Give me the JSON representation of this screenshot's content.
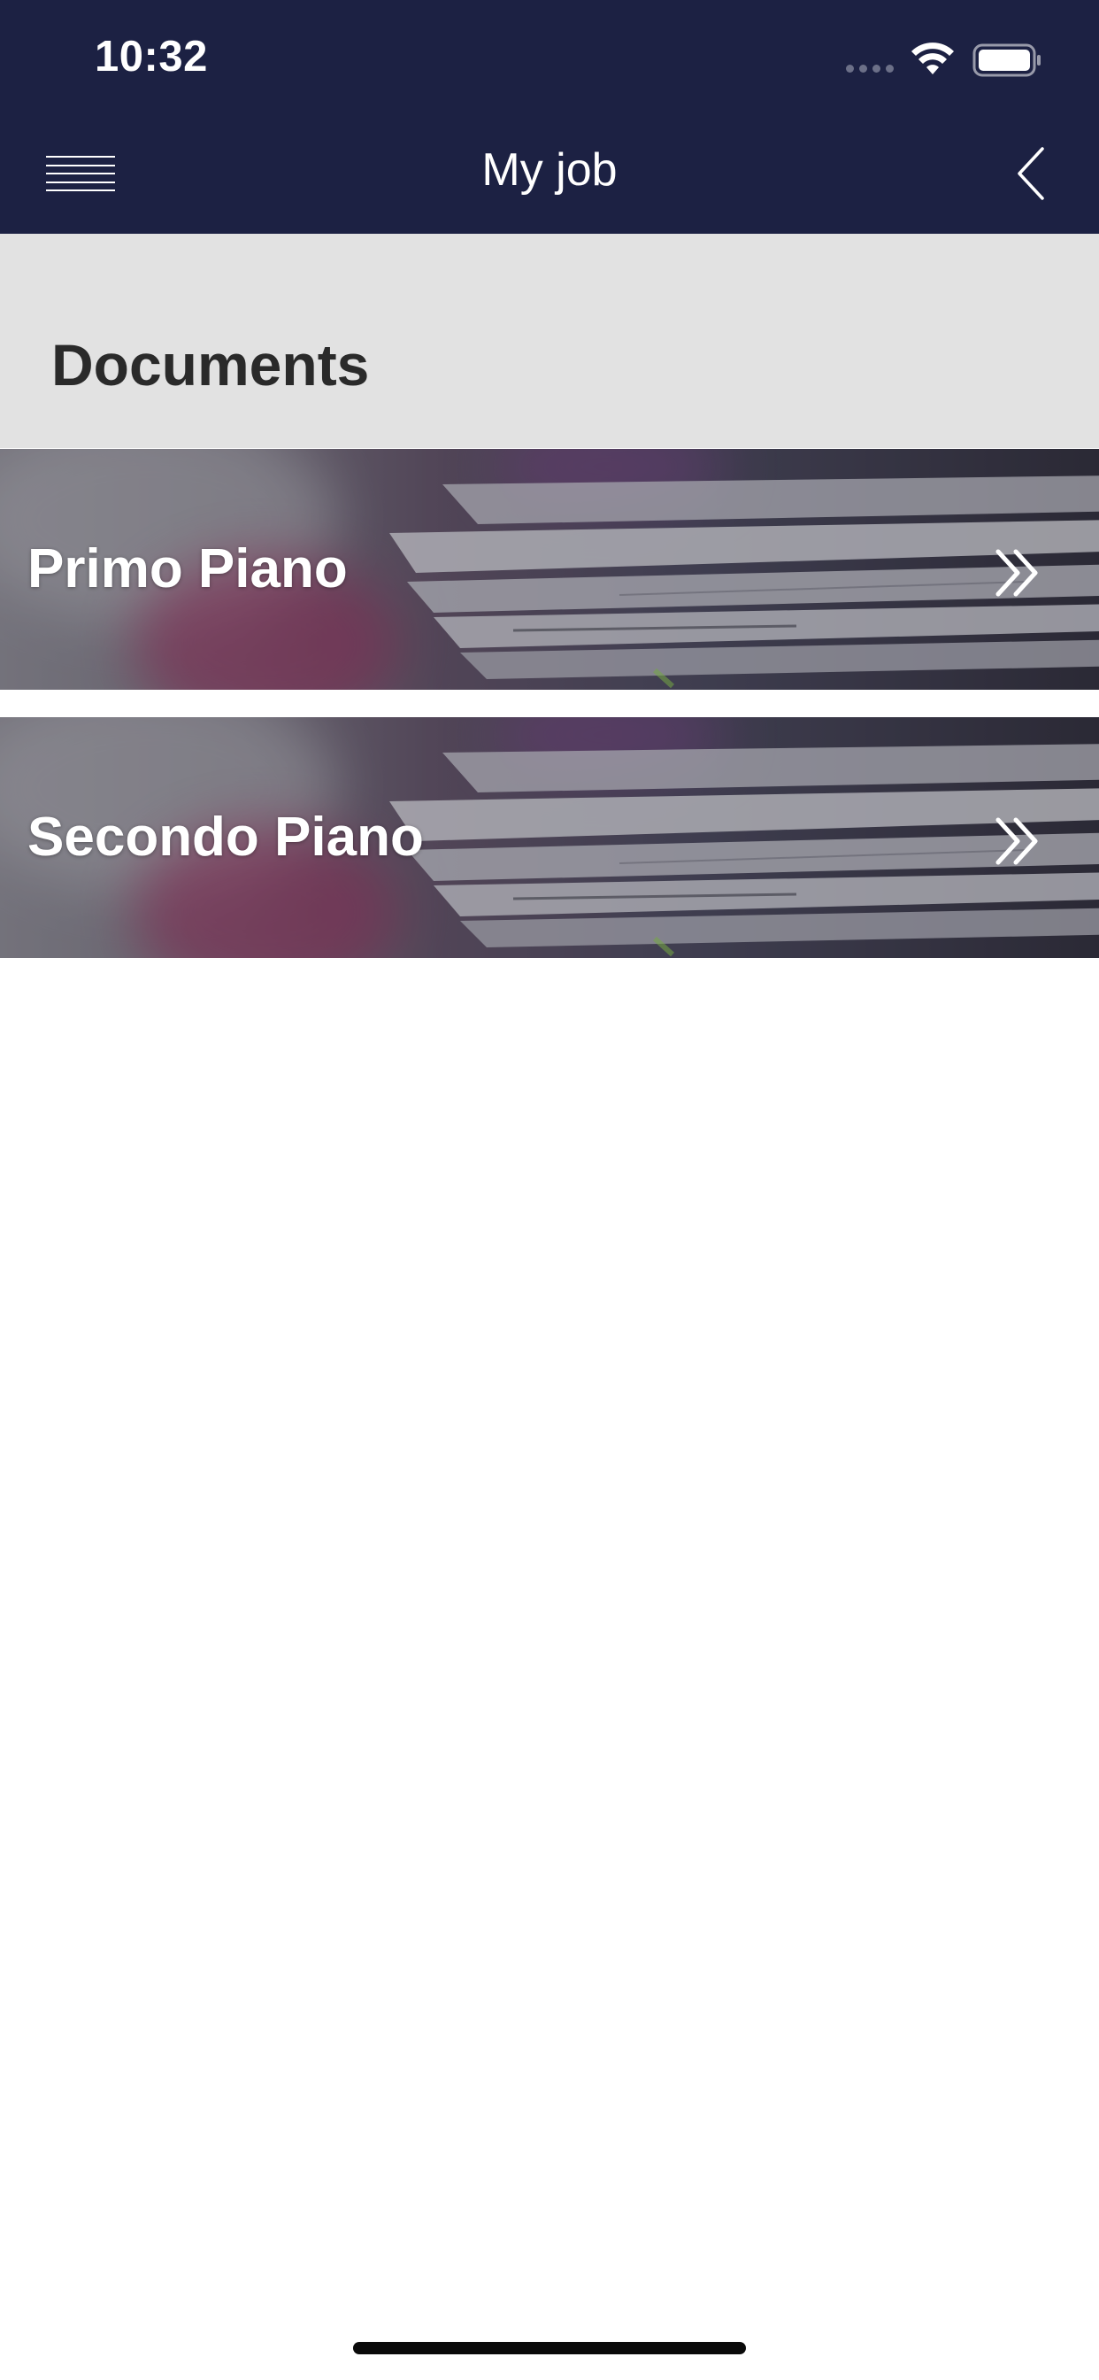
{
  "status_bar": {
    "time": "10:32"
  },
  "nav_bar": {
    "title": "My job",
    "menu_icon": "hamburger-menu-icon",
    "back_icon": "chevron-left-icon",
    "background_color": "#1c2143"
  },
  "section": {
    "title": "Documents",
    "background_color": "#e2e2e2"
  },
  "documents": [
    {
      "label": "Primo Piano",
      "icon": "double-chevron-right-icon"
    },
    {
      "label": "Secondo Piano",
      "icon": "double-chevron-right-icon"
    }
  ]
}
